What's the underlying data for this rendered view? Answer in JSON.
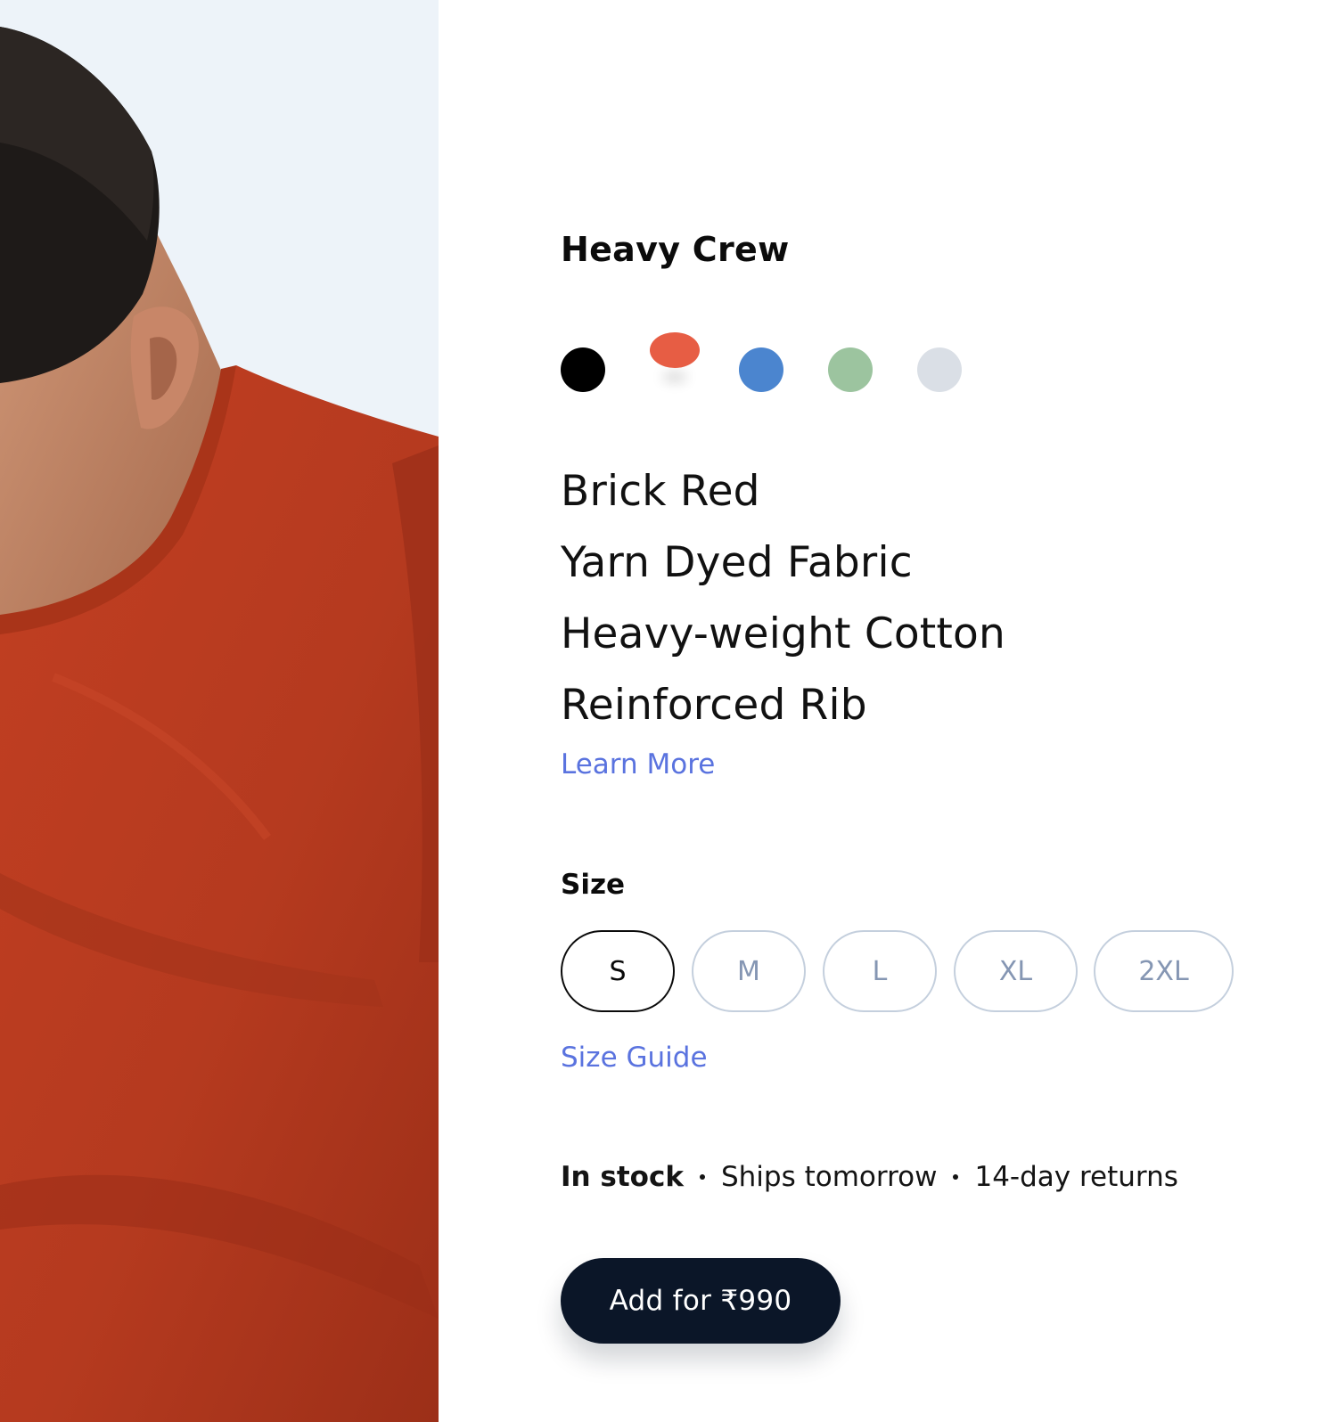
{
  "product": {
    "title": "Heavy Crew"
  },
  "colors": {
    "selected_name": "Brick Red",
    "swatches": [
      {
        "name": "black",
        "hex": "#000000",
        "selected": false
      },
      {
        "name": "brick-red",
        "hex": "#e75d44",
        "selected": true
      },
      {
        "name": "blue",
        "hex": "#4b85cf",
        "selected": false
      },
      {
        "name": "sage-green",
        "hex": "#9cc49f",
        "selected": false
      },
      {
        "name": "light-grey",
        "hex": "#dadfe6",
        "selected": false
      }
    ]
  },
  "features": [
    "Brick Red",
    "Yarn Dyed Fabric",
    "Heavy-weight Cotton",
    "Reinforced Rib"
  ],
  "learn_more": "Learn More",
  "size": {
    "label": "Size",
    "options": [
      "S",
      "M",
      "L",
      "XL",
      "2XL"
    ],
    "selected": "S",
    "guide_link": "Size Guide"
  },
  "availability": {
    "stock": "In stock",
    "shipping": "Ships tomorrow",
    "returns": "14-day returns"
  },
  "cta": {
    "label": "Add for ₹990"
  },
  "theme": {
    "link_color": "#5a73df",
    "cta_bg": "#0b1628",
    "shirt_color": "#b8391f",
    "photo_bg": "#edf3f9"
  }
}
